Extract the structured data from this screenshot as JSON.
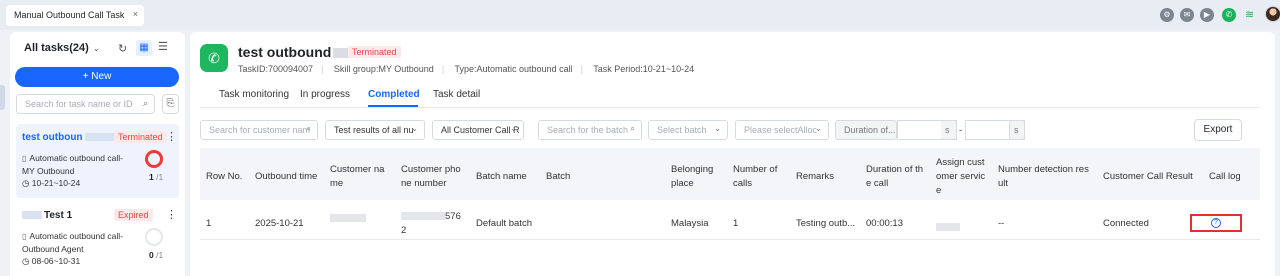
{
  "window": {
    "tab_title": "Manual Outbound Call Task",
    "tab_close": "×"
  },
  "topbar_icons": [
    "gear-icon",
    "chat-icon",
    "video-icon",
    "phone-icon"
  ],
  "sidebar": {
    "title": "All tasks(24)",
    "new_button": "+ New",
    "search_placeholder": "Search for task name or ID",
    "tasks": [
      {
        "name": "test outboun",
        "status": "Terminated",
        "desc": "Automatic outbound call-MY Outbound",
        "dates": "10-21~10-24",
        "progress": "1",
        "total": "/1"
      },
      {
        "name": "Test 1",
        "status": "Expired",
        "desc": "Automatic outbound call-Outbound Agent",
        "dates": "08-06~10-31",
        "progress": "0",
        "total": "/1"
      }
    ]
  },
  "task": {
    "title": "test outbound",
    "status": "Terminated",
    "id": "TaskID:700094007",
    "skill_group": "Skill group:MY Outbound",
    "type": "Type:Automatic outbound call",
    "period": "Task Period:10-21~10-24"
  },
  "tabs": [
    "Task monitoring",
    "In progress",
    "Completed",
    "Task detail"
  ],
  "filters": {
    "customer_name": "Search for customer nam",
    "results": "Test results of all nu",
    "call_result": "All Customer Call R",
    "batch_search": "Search for the batch",
    "select_batch": "Select batch",
    "allocation": "Please selectAlloc",
    "duration": "Duration of...",
    "unit": "s",
    "dash": "-",
    "export": "Export"
  },
  "table": {
    "headers": [
      "Row No.",
      "Outbound time",
      "Customer na me",
      "Customer pho ne number",
      "Batch name",
      "Batch",
      "Belonging place",
      "Number of calls",
      "Remarks",
      "Duration of th e call",
      "Assign cust omer servic e",
      "Number detection res ult",
      "Customer Call Result",
      "Call log"
    ],
    "rows": [
      [
        "1",
        "2025-10-21",
        "",
        "576 2",
        "Default batch",
        "",
        "Malaysia",
        "1",
        "Testing outb...",
        "00:00:13",
        "",
        "--",
        "Connected",
        ""
      ]
    ]
  }
}
